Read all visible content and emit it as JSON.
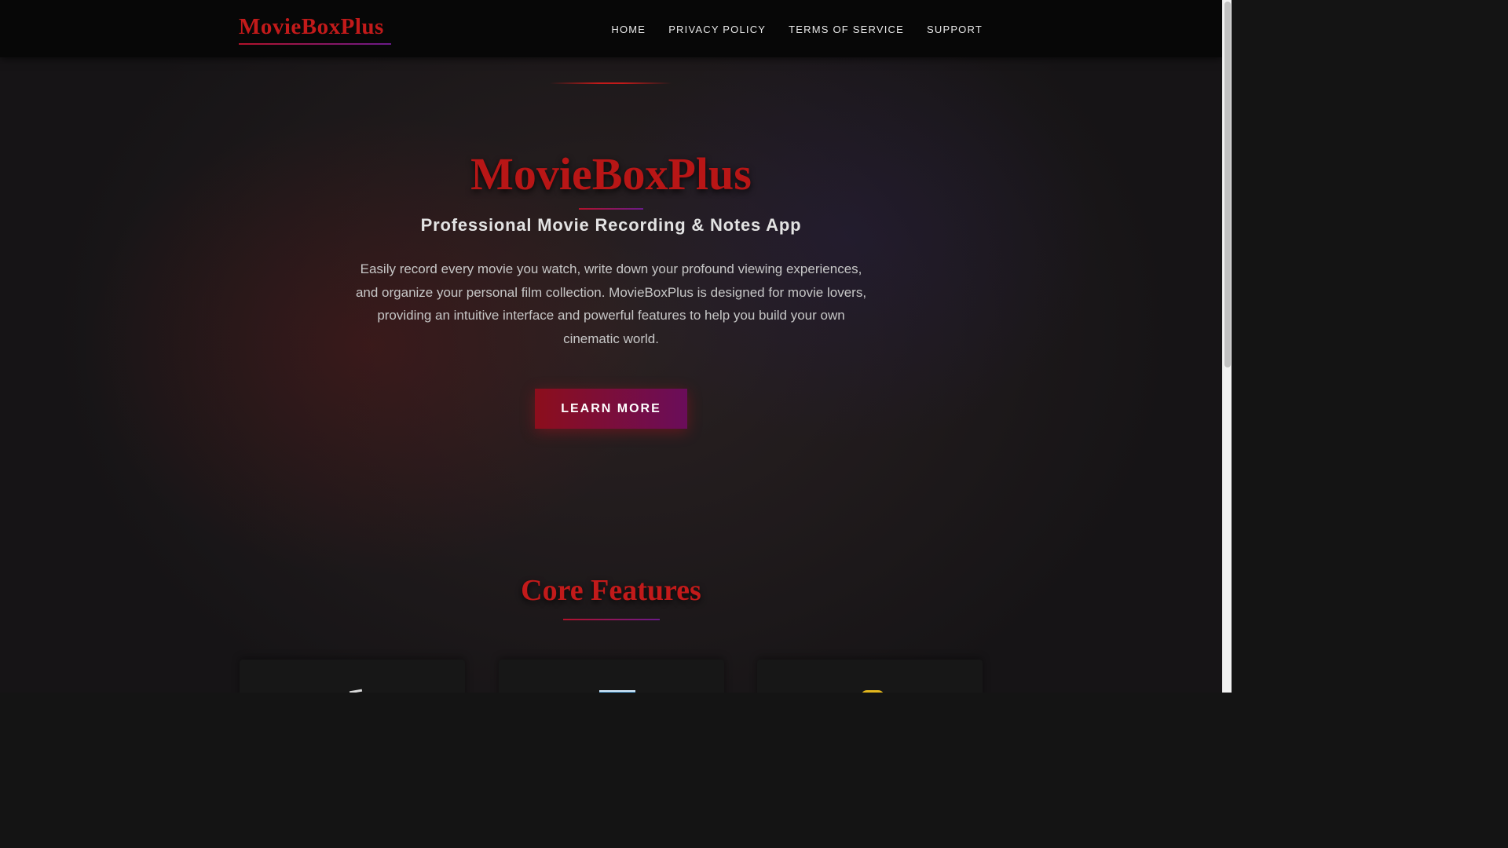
{
  "header": {
    "logo": "MovieBoxPlus",
    "nav": [
      {
        "label": "HOME"
      },
      {
        "label": "PRIVACY POLICY"
      },
      {
        "label": "TERMS OF SERVICE"
      },
      {
        "label": "SUPPORT"
      }
    ]
  },
  "hero": {
    "title": "MovieBoxPlus",
    "subtitle": "Professional Movie Recording & Notes App",
    "description": "Easily record every movie you watch, write down your profound viewing experiences, and organize your personal film collection. MovieBoxPlus is designed for movie lovers, providing an intuitive interface and powerful features to help you build your own cinematic world.",
    "cta_label": "LEARN MORE"
  },
  "features": {
    "title": "Core Features",
    "cards": [
      {
        "icon": "clapperboard-icon"
      },
      {
        "icon": "notes-icon"
      },
      {
        "icon": "star-icon"
      }
    ]
  },
  "colors": {
    "brand_red": "#c21a1a",
    "accent_purple": "#6a1a8a",
    "header_bg": "#070707"
  }
}
